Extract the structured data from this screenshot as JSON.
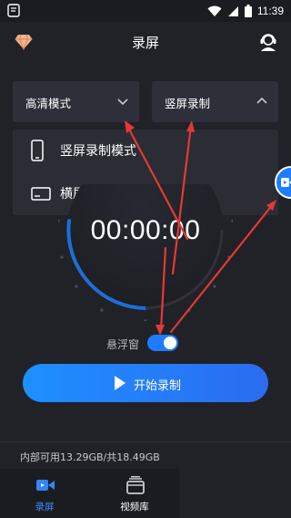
{
  "status_bar": {
    "time": "11:39",
    "icons": [
      "app-notification-icon",
      "wifi-icon",
      "signal-icon",
      "battery-icon"
    ]
  },
  "header": {
    "title": "录屏",
    "left_icon": "vip-diamond-icon",
    "right_icon": "customer-service-icon"
  },
  "quality_dropdown": {
    "label": "高清模式",
    "state": "collapsed"
  },
  "orientation_dropdown": {
    "label": "竖屏录制",
    "state": "expanded"
  },
  "orientation_menu": {
    "items": [
      {
        "label": "竖屏录制模式",
        "icon": "portrait-phone-icon"
      },
      {
        "label": "横屏录制模式",
        "icon": "landscape-screen-icon"
      }
    ]
  },
  "timer": "00:00:00",
  "floating_window": {
    "label": "悬浮窗",
    "enabled": true
  },
  "start_button": {
    "label": "开始录制"
  },
  "storage": {
    "text": "内部可用13.29GB/共18.49GB"
  },
  "bottom_nav": {
    "items": [
      {
        "label": "录屏",
        "icon": "screen-record-icon",
        "active": true
      },
      {
        "label": "视频库",
        "icon": "video-library-icon",
        "active": false
      }
    ]
  },
  "colors": {
    "background": "#202228",
    "panel": "#2d3038",
    "accent": "#1f7bff",
    "annotation": "#e53935"
  }
}
